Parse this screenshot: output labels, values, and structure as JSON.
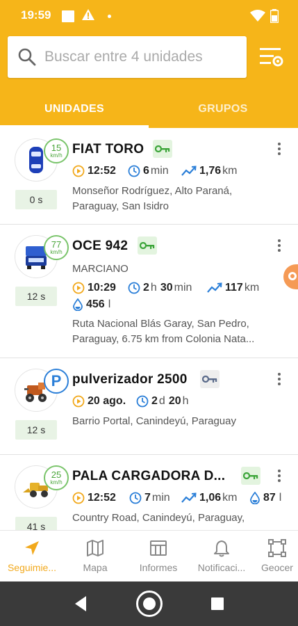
{
  "status_bar": {
    "time": "19:59"
  },
  "search": {
    "placeholder": "Buscar entre 4 unidades"
  },
  "tabs": [
    {
      "label": "UNIDADES",
      "active": true
    },
    {
      "label": "GRUPOS",
      "active": false
    }
  ],
  "units": [
    {
      "name": "FIAT TORO",
      "icon": "car-icon",
      "speed_value": "15",
      "speed_unit": "km/h",
      "age": "0 s",
      "ignition": "on",
      "stats": {
        "time": "12:52",
        "duration_value": "6",
        "duration_unit": "min",
        "distance_value": "1,76",
        "distance_unit": "km"
      },
      "address_lines": [
        "Monseñor Rodríguez, Alto Paraná,",
        "Paraguay, San Isidro"
      ]
    },
    {
      "name": "OCE 942",
      "icon": "truck-icon",
      "speed_value": "77",
      "speed_unit": "km/h",
      "age": "12 s",
      "ignition": "on",
      "driver": "MARCIANO",
      "stats": {
        "time": "10:29",
        "duration_h": "2",
        "duration_h_unit": "h",
        "duration_m": "30",
        "duration_m_unit": "min",
        "distance_value": "117",
        "distance_unit": "km",
        "fuel_value": "456",
        "fuel_unit": "l"
      },
      "address_lines": [
        "Ruta Nacional Blás Garay, San Pedro,",
        "Paraguay, 6.75 km from Colonia Nata..."
      ]
    },
    {
      "name": "pulverizador 2500",
      "icon": "sprayer-icon",
      "parking": "P",
      "age": "12 s",
      "ignition": "off",
      "stats": {
        "date": "20 ago.",
        "duration_d": "2",
        "duration_d_unit": "d",
        "duration_h": "20",
        "duration_h_unit": "h"
      },
      "address_lines": [
        "Barrio Portal, Canindeyú, Paraguay"
      ]
    },
    {
      "name": "PALA CARGADORA D...",
      "icon": "loader-icon",
      "speed_value": "25",
      "speed_unit": "km/h",
      "age": "41 s",
      "ignition": "on",
      "stats": {
        "time": "12:52",
        "duration_value": "7",
        "duration_unit": "min",
        "distance_value": "1,06",
        "distance_unit": "km",
        "fuel_value": "87",
        "fuel_unit": "l"
      },
      "address_lines": [
        "Country Road, Canindeyú, Paraguay,"
      ]
    }
  ],
  "bottom_nav": [
    {
      "label": "Seguimie...",
      "icon": "navigation-arrow-icon",
      "active": true
    },
    {
      "label": "Mapa",
      "icon": "map-icon",
      "active": false
    },
    {
      "label": "Informes",
      "icon": "report-icon",
      "active": false
    },
    {
      "label": "Notificaci...",
      "icon": "bell-icon",
      "active": false
    },
    {
      "label": "Geocer",
      "icon": "geofence-icon",
      "active": false
    }
  ],
  "colors": {
    "brand": "#f6b519",
    "speed_green": "#79c46a",
    "clock_orange": "#f2a91c",
    "duration_blue": "#2b7fd8",
    "parking_blue": "#2b7fd8"
  }
}
